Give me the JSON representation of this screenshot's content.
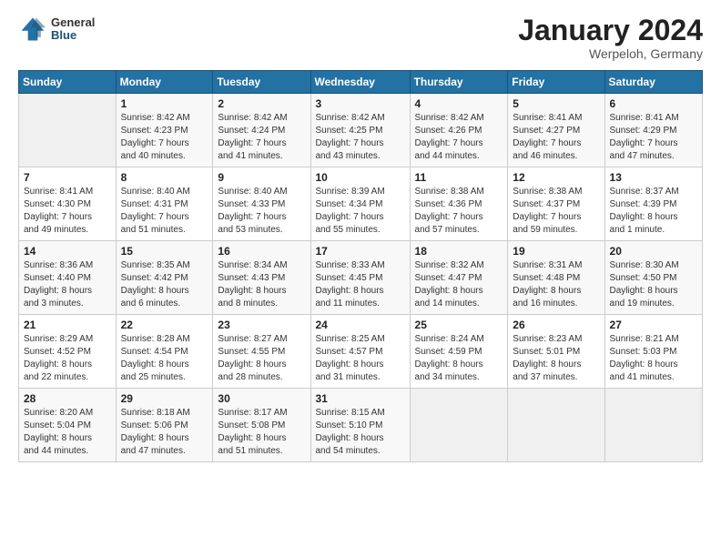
{
  "header": {
    "logo": {
      "general": "General",
      "blue": "Blue"
    },
    "month_title": "January 2024",
    "location": "Werpeloh, Germany"
  },
  "calendar": {
    "days_of_week": [
      "Sunday",
      "Monday",
      "Tuesday",
      "Wednesday",
      "Thursday",
      "Friday",
      "Saturday"
    ],
    "weeks": [
      [
        {
          "day": "",
          "info": ""
        },
        {
          "day": "1",
          "info": "Sunrise: 8:42 AM\nSunset: 4:23 PM\nDaylight: 7 hours\nand 40 minutes."
        },
        {
          "day": "2",
          "info": "Sunrise: 8:42 AM\nSunset: 4:24 PM\nDaylight: 7 hours\nand 41 minutes."
        },
        {
          "day": "3",
          "info": "Sunrise: 8:42 AM\nSunset: 4:25 PM\nDaylight: 7 hours\nand 43 minutes."
        },
        {
          "day": "4",
          "info": "Sunrise: 8:42 AM\nSunset: 4:26 PM\nDaylight: 7 hours\nand 44 minutes."
        },
        {
          "day": "5",
          "info": "Sunrise: 8:41 AM\nSunset: 4:27 PM\nDaylight: 7 hours\nand 46 minutes."
        },
        {
          "day": "6",
          "info": "Sunrise: 8:41 AM\nSunset: 4:29 PM\nDaylight: 7 hours\nand 47 minutes."
        }
      ],
      [
        {
          "day": "7",
          "info": "Sunrise: 8:41 AM\nSunset: 4:30 PM\nDaylight: 7 hours\nand 49 minutes."
        },
        {
          "day": "8",
          "info": "Sunrise: 8:40 AM\nSunset: 4:31 PM\nDaylight: 7 hours\nand 51 minutes."
        },
        {
          "day": "9",
          "info": "Sunrise: 8:40 AM\nSunset: 4:33 PM\nDaylight: 7 hours\nand 53 minutes."
        },
        {
          "day": "10",
          "info": "Sunrise: 8:39 AM\nSunset: 4:34 PM\nDaylight: 7 hours\nand 55 minutes."
        },
        {
          "day": "11",
          "info": "Sunrise: 8:38 AM\nSunset: 4:36 PM\nDaylight: 7 hours\nand 57 minutes."
        },
        {
          "day": "12",
          "info": "Sunrise: 8:38 AM\nSunset: 4:37 PM\nDaylight: 7 hours\nand 59 minutes."
        },
        {
          "day": "13",
          "info": "Sunrise: 8:37 AM\nSunset: 4:39 PM\nDaylight: 8 hours\nand 1 minute."
        }
      ],
      [
        {
          "day": "14",
          "info": "Sunrise: 8:36 AM\nSunset: 4:40 PM\nDaylight: 8 hours\nand 3 minutes."
        },
        {
          "day": "15",
          "info": "Sunrise: 8:35 AM\nSunset: 4:42 PM\nDaylight: 8 hours\nand 6 minutes."
        },
        {
          "day": "16",
          "info": "Sunrise: 8:34 AM\nSunset: 4:43 PM\nDaylight: 8 hours\nand 8 minutes."
        },
        {
          "day": "17",
          "info": "Sunrise: 8:33 AM\nSunset: 4:45 PM\nDaylight: 8 hours\nand 11 minutes."
        },
        {
          "day": "18",
          "info": "Sunrise: 8:32 AM\nSunset: 4:47 PM\nDaylight: 8 hours\nand 14 minutes."
        },
        {
          "day": "19",
          "info": "Sunrise: 8:31 AM\nSunset: 4:48 PM\nDaylight: 8 hours\nand 16 minutes."
        },
        {
          "day": "20",
          "info": "Sunrise: 8:30 AM\nSunset: 4:50 PM\nDaylight: 8 hours\nand 19 minutes."
        }
      ],
      [
        {
          "day": "21",
          "info": "Sunrise: 8:29 AM\nSunset: 4:52 PM\nDaylight: 8 hours\nand 22 minutes."
        },
        {
          "day": "22",
          "info": "Sunrise: 8:28 AM\nSunset: 4:54 PM\nDaylight: 8 hours\nand 25 minutes."
        },
        {
          "day": "23",
          "info": "Sunrise: 8:27 AM\nSunset: 4:55 PM\nDaylight: 8 hours\nand 28 minutes."
        },
        {
          "day": "24",
          "info": "Sunrise: 8:25 AM\nSunset: 4:57 PM\nDaylight: 8 hours\nand 31 minutes."
        },
        {
          "day": "25",
          "info": "Sunrise: 8:24 AM\nSunset: 4:59 PM\nDaylight: 8 hours\nand 34 minutes."
        },
        {
          "day": "26",
          "info": "Sunrise: 8:23 AM\nSunset: 5:01 PM\nDaylight: 8 hours\nand 37 minutes."
        },
        {
          "day": "27",
          "info": "Sunrise: 8:21 AM\nSunset: 5:03 PM\nDaylight: 8 hours\nand 41 minutes."
        }
      ],
      [
        {
          "day": "28",
          "info": "Sunrise: 8:20 AM\nSunset: 5:04 PM\nDaylight: 8 hours\nand 44 minutes."
        },
        {
          "day": "29",
          "info": "Sunrise: 8:18 AM\nSunset: 5:06 PM\nDaylight: 8 hours\nand 47 minutes."
        },
        {
          "day": "30",
          "info": "Sunrise: 8:17 AM\nSunset: 5:08 PM\nDaylight: 8 hours\nand 51 minutes."
        },
        {
          "day": "31",
          "info": "Sunrise: 8:15 AM\nSunset: 5:10 PM\nDaylight: 8 hours\nand 54 minutes."
        },
        {
          "day": "",
          "info": ""
        },
        {
          "day": "",
          "info": ""
        },
        {
          "day": "",
          "info": ""
        }
      ]
    ]
  }
}
